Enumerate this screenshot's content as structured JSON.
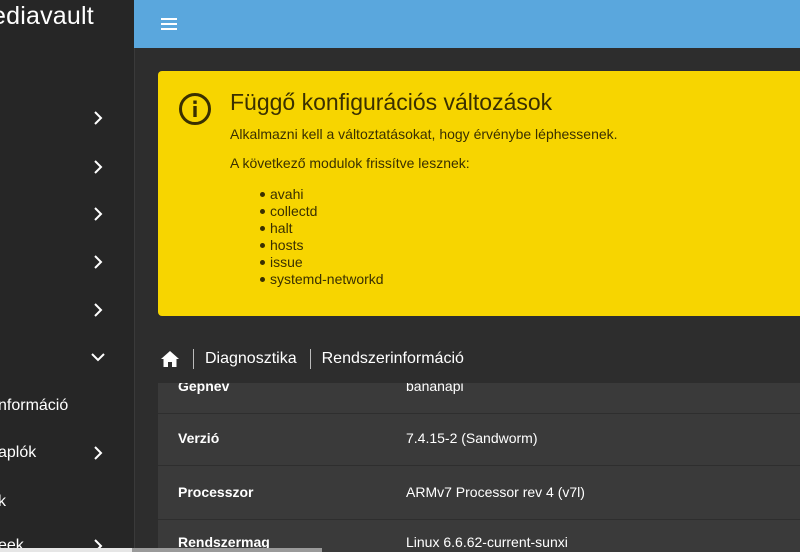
{
  "app": {
    "brand": "ediavault"
  },
  "sidebar": {
    "items": [
      {
        "label": "",
        "expanded": false
      },
      {
        "label": "",
        "expanded": false
      },
      {
        "label": "",
        "expanded": false
      },
      {
        "label": "",
        "expanded": false
      },
      {
        "label": "",
        "expanded": false
      },
      {
        "label": "",
        "expanded": true
      },
      {
        "label": "nformáció"
      },
      {
        "label": "aplók",
        "expanded": false
      },
      {
        "label": "k"
      },
      {
        "label": "eek",
        "expanded": false
      }
    ]
  },
  "alert": {
    "title": "Függő konfigurációs változások",
    "message": "Alkalmazni kell a változtatásokat, hogy érvénybe léphessenek.",
    "modules_intro": "A következő modulok frissítve lesznek:",
    "modules": [
      "avahi",
      "collectd",
      "halt",
      "hosts",
      "issue",
      "systemd-networkd"
    ],
    "icon": "info-circle-icon",
    "color": "#f7d500"
  },
  "breadcrumb": {
    "home_icon": "home-icon",
    "items": [
      "Diagnosztika",
      "Rendszerinformáció"
    ]
  },
  "info": {
    "rows": [
      {
        "key": "Gépnév",
        "value": "bananapi"
      },
      {
        "key": "Verzió",
        "value": "7.4.15-2 (Sandworm)"
      },
      {
        "key": "Processzor",
        "value": "ARMv7 Processor rev 4 (v7l)"
      },
      {
        "key": "Rendszermag",
        "value": "Linux 6.6.62-current-sunxi"
      }
    ]
  },
  "colors": {
    "topbar": "#5aa7dd",
    "sidebar": "#262626",
    "main": "#2d2d2d"
  }
}
